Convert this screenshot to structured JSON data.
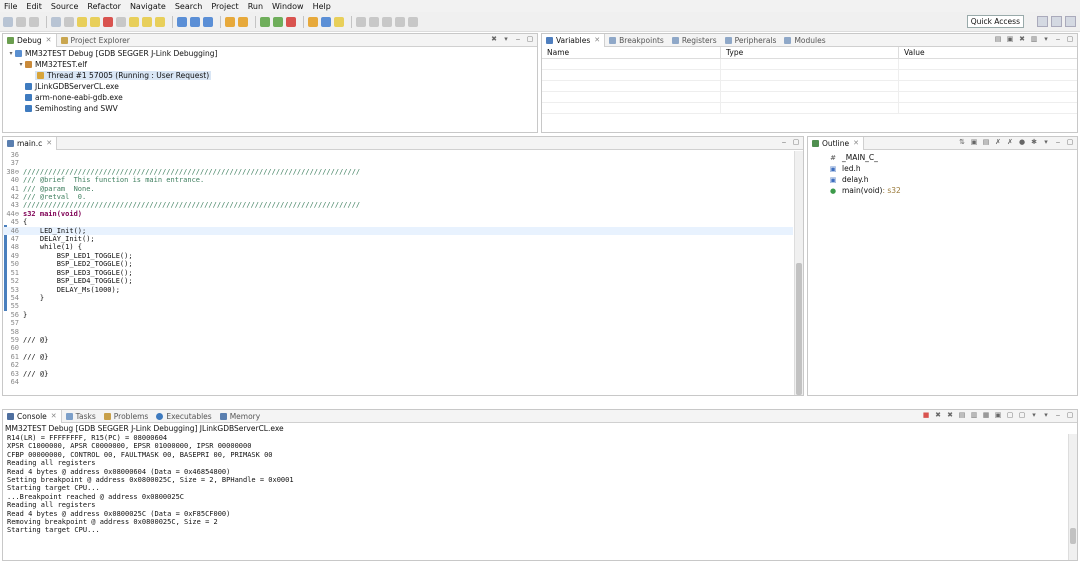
{
  "menu": [
    "File",
    "Edit",
    "Source",
    "Refactor",
    "Navigate",
    "Search",
    "Project",
    "Run",
    "Window",
    "Help"
  ],
  "quick_access": "Quick Access",
  "debug_panel": {
    "tabs": [
      {
        "label": "Debug"
      },
      {
        "label": "Project Explorer"
      }
    ],
    "tree": [
      {
        "label": "MM32TEST Debug [GDB SEGGER J-Link Debugging]",
        "icon": "debug-config-icon"
      },
      {
        "label": "MM32TEST.elf",
        "icon": "elf-process-icon"
      },
      {
        "label": "Thread #1 57005 (Running : User Request)",
        "icon": "thread-icon"
      },
      {
        "label": "JLinkGDBServerCL.exe",
        "icon": "exe-icon"
      },
      {
        "label": "arm-none-eabi-gdb.exe",
        "icon": "exe-icon"
      },
      {
        "label": "Semihosting and SWV",
        "icon": "exe-icon"
      }
    ]
  },
  "variables_panel": {
    "tabs": [
      "Variables",
      "Breakpoints",
      "Registers",
      "Peripherals",
      "Modules"
    ],
    "columns": [
      "Name",
      "Type",
      "Value"
    ]
  },
  "editor": {
    "tab": "main.c",
    "lines": [
      {
        "n": "36",
        "t": ""
      },
      {
        "n": "37",
        "t": ""
      },
      {
        "n": "38⊖",
        "t": "////////////////////////////////////////////////////////////////////////////////",
        "c": "cm"
      },
      {
        "n": "40",
        "t": "/// @brief  This function is main entrance.",
        "c": "cm"
      },
      {
        "n": "41",
        "t": "/// @param  None.",
        "c": "cm"
      },
      {
        "n": "42",
        "t": "/// @retval  0.",
        "c": "cm"
      },
      {
        "n": "43",
        "t": "////////////////////////////////////////////////////////////////////////////////",
        "c": "cm"
      },
      {
        "n": "44⊖",
        "t": "s32 main(void)",
        "c": "kw"
      },
      {
        "n": "45",
        "t": "{"
      },
      {
        "n": "46",
        "t": "    LED_Init();",
        "cur": true
      },
      {
        "n": "47",
        "t": "    DELAY_Init();"
      },
      {
        "n": "48",
        "t": "    while(1) {"
      },
      {
        "n": "49",
        "t": "        BSP_LED1_TOGGLE();"
      },
      {
        "n": "50",
        "t": "        BSP_LED2_TOGGLE();"
      },
      {
        "n": "51",
        "t": "        BSP_LED3_TOGGLE();"
      },
      {
        "n": "52",
        "t": "        BSP_LED4_TOGGLE();"
      },
      {
        "n": "53",
        "t": "        DELAY_Ms(1000);"
      },
      {
        "n": "54",
        "t": "    }"
      },
      {
        "n": "55",
        "t": ""
      },
      {
        "n": "56",
        "t": "}"
      },
      {
        "n": "57",
        "t": ""
      },
      {
        "n": "58",
        "t": ""
      },
      {
        "n": "59",
        "t": "/// @}"
      },
      {
        "n": "60",
        "t": ""
      },
      {
        "n": "61",
        "t": "/// @}"
      },
      {
        "n": "62",
        "t": ""
      },
      {
        "n": "63",
        "t": "/// @}"
      },
      {
        "n": "64",
        "t": ""
      }
    ]
  },
  "outline": {
    "tab": "Outline",
    "items": [
      {
        "label": "_MAIN_C_",
        "icon": "hash-icon",
        "glyph": "#"
      },
      {
        "label": "led.h",
        "icon": "include-icon",
        "glyph": "▣"
      },
      {
        "label": "delay.h",
        "icon": "include-icon",
        "glyph": "▣"
      },
      {
        "label": "main(void)",
        "type": " : s32",
        "icon": "function-icon",
        "glyph": "●"
      }
    ]
  },
  "console": {
    "tabs": [
      "Console",
      "Tasks",
      "Problems",
      "Executables",
      "Memory"
    ],
    "title": "MM32TEST Debug [GDB SEGGER J-Link Debugging] JLinkGDBServerCL.exe",
    "lines": [
      "R14(LR) = FFFFFFFF, R15(PC) = 08000604",
      "XPSR C1000000, APSR C0000000, EPSR 01000000, IPSR 00000000",
      "CFBP 00000000, CONTROL 00, FAULTMASK 00, BASEPRI 00, PRIMASK 00",
      "Reading all registers",
      "Read 4 bytes @ address 0x08000604 (Data = 0x46854800)",
      "Setting breakpoint @ address 0x0800025C, Size = 2, BPHandle = 0x0001",
      "Starting target CPU...",
      "...Breakpoint reached @ address 0x0800025C",
      "Reading all registers",
      "Read 4 bytes @ address 0x0800025C (Data = 0xF85CF000)",
      "Removing breakpoint @ address 0x0800025C, Size = 2",
      "Starting target CPU..."
    ]
  }
}
